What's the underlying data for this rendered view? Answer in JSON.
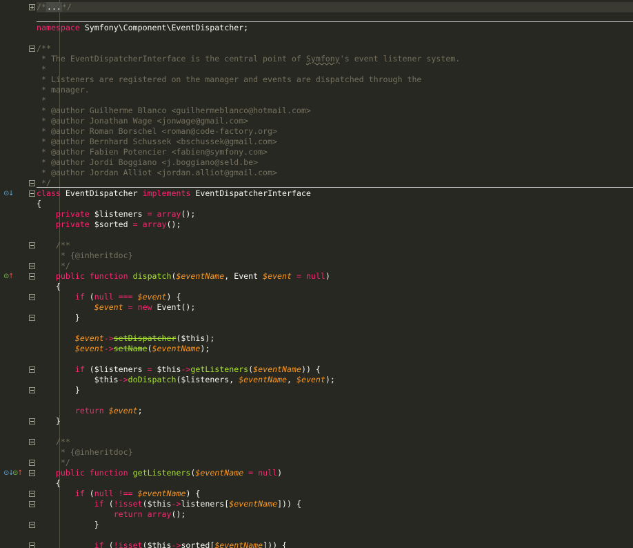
{
  "editor": {
    "language": "php",
    "colors": {
      "background": "#272822",
      "keyword": "#f92672",
      "function": "#a6e22e",
      "variable": "#fd971f",
      "comment": "#75715e",
      "text": "#f8f8f2"
    }
  },
  "lines": [
    {
      "t": [
        {
          "c": "cm",
          "v": "/*"
        },
        {
          "c": "fb",
          "v": "..."
        },
        {
          "c": "cm",
          "v": "*/"
        }
      ],
      "current": true
    },
    {
      "t": []
    },
    {
      "t": [
        {
          "c": "kw",
          "v": "namespace"
        },
        {
          "c": "plain",
          "v": " Symfony\\Component\\EventDispatcher;"
        }
      ]
    },
    {
      "t": []
    },
    {
      "t": [
        {
          "c": "cm",
          "v": "/**"
        }
      ]
    },
    {
      "t": [
        {
          "c": "cm",
          "v": " * The EventDispatcherInterface is the central point of "
        },
        {
          "c": "cmu",
          "v": "Symfony"
        },
        {
          "c": "cm",
          "v": "'s event listener system."
        }
      ]
    },
    {
      "t": [
        {
          "c": "cm",
          "v": " *"
        }
      ]
    },
    {
      "t": [
        {
          "c": "cm",
          "v": " * Listeners are registered on the manager and events are dispatched through the"
        }
      ]
    },
    {
      "t": [
        {
          "c": "cm",
          "v": " * manager."
        }
      ]
    },
    {
      "t": [
        {
          "c": "cm",
          "v": " *"
        }
      ]
    },
    {
      "t": [
        {
          "c": "cm",
          "v": " * @author Guilherme Blanco <guilhermeblanco@hotmail.com>"
        }
      ]
    },
    {
      "t": [
        {
          "c": "cm",
          "v": " * @author Jonathan Wage <jonwage@gmail.com>"
        }
      ]
    },
    {
      "t": [
        {
          "c": "cm",
          "v": " * @author Roman Borschel <roman@code-factory.org>"
        }
      ]
    },
    {
      "t": [
        {
          "c": "cm",
          "v": " * @author Bernhard Schussek <bschussek@gmail.com>"
        }
      ]
    },
    {
      "t": [
        {
          "c": "cm",
          "v": " * @author Fabien Potencier <fabien@symfony.com>"
        }
      ]
    },
    {
      "t": [
        {
          "c": "cm",
          "v": " * @author Jordi Boggiano <j.boggiano@seld.be>"
        }
      ]
    },
    {
      "t": [
        {
          "c": "cm",
          "v": " * @author Jordan Alliot <jordan.alliot@gmail.com>"
        }
      ]
    },
    {
      "t": [
        {
          "c": "cm",
          "v": " */"
        }
      ]
    },
    {
      "t": [
        {
          "c": "kw",
          "v": "class"
        },
        {
          "c": "plain",
          "v": " EventDispatcher "
        },
        {
          "c": "kw",
          "v": "implements"
        },
        {
          "c": "plain",
          "v": " EventDispatcherInterface"
        }
      ]
    },
    {
      "t": [
        {
          "c": "plain",
          "v": "{"
        }
      ]
    },
    {
      "t": [
        {
          "c": "plain",
          "v": "    "
        },
        {
          "c": "kw",
          "v": "private"
        },
        {
          "c": "plain",
          "v": " $listeners "
        },
        {
          "c": "kw",
          "v": "="
        },
        {
          "c": "plain",
          "v": " "
        },
        {
          "c": "kw",
          "v": "array"
        },
        {
          "c": "plain",
          "v": "();"
        }
      ]
    },
    {
      "t": [
        {
          "c": "plain",
          "v": "    "
        },
        {
          "c": "kw",
          "v": "private"
        },
        {
          "c": "plain",
          "v": " $sorted "
        },
        {
          "c": "kw",
          "v": "="
        },
        {
          "c": "plain",
          "v": " "
        },
        {
          "c": "kw",
          "v": "array"
        },
        {
          "c": "plain",
          "v": "();"
        }
      ]
    },
    {
      "t": []
    },
    {
      "t": [
        {
          "c": "cm",
          "v": "    /**"
        }
      ]
    },
    {
      "t": [
        {
          "c": "cm",
          "v": "     * {@inheritdoc}"
        }
      ]
    },
    {
      "t": [
        {
          "c": "cm",
          "v": "     */"
        }
      ]
    },
    {
      "t": [
        {
          "c": "plain",
          "v": "    "
        },
        {
          "c": "kw",
          "v": "public"
        },
        {
          "c": "plain",
          "v": " "
        },
        {
          "c": "kw",
          "v": "function"
        },
        {
          "c": "plain",
          "v": " "
        },
        {
          "c": "fn",
          "v": "dispatch"
        },
        {
          "c": "plain",
          "v": "("
        },
        {
          "c": "var",
          "v": "$eventName"
        },
        {
          "c": "plain",
          "v": ", Event "
        },
        {
          "c": "var",
          "v": "$event"
        },
        {
          "c": "plain",
          "v": " "
        },
        {
          "c": "kw",
          "v": "="
        },
        {
          "c": "plain",
          "v": " "
        },
        {
          "c": "kw",
          "v": "null"
        },
        {
          "c": "plain",
          "v": ")"
        }
      ]
    },
    {
      "t": [
        {
          "c": "plain",
          "v": "    {"
        }
      ]
    },
    {
      "t": [
        {
          "c": "plain",
          "v": "        "
        },
        {
          "c": "kw",
          "v": "if"
        },
        {
          "c": "plain",
          "v": " ("
        },
        {
          "c": "kw",
          "v": "null"
        },
        {
          "c": "plain",
          "v": " "
        },
        {
          "c": "kw",
          "v": "==="
        },
        {
          "c": "plain",
          "v": " "
        },
        {
          "c": "var",
          "v": "$event"
        },
        {
          "c": "plain",
          "v": ") {"
        }
      ]
    },
    {
      "t": [
        {
          "c": "plain",
          "v": "            "
        },
        {
          "c": "var",
          "v": "$event"
        },
        {
          "c": "plain",
          "v": " "
        },
        {
          "c": "kw",
          "v": "="
        },
        {
          "c": "plain",
          "v": " "
        },
        {
          "c": "kw",
          "v": "new"
        },
        {
          "c": "plain",
          "v": " Event();"
        }
      ]
    },
    {
      "t": [
        {
          "c": "plain",
          "v": "        }"
        }
      ]
    },
    {
      "t": []
    },
    {
      "t": [
        {
          "c": "plain",
          "v": "        "
        },
        {
          "c": "var",
          "v": "$event"
        },
        {
          "c": "kw",
          "v": "->"
        },
        {
          "c": "fns",
          "v": "setDispatcher"
        },
        {
          "c": "plain",
          "v": "($this);"
        }
      ]
    },
    {
      "t": [
        {
          "c": "plain",
          "v": "        "
        },
        {
          "c": "var",
          "v": "$event"
        },
        {
          "c": "kw",
          "v": "->"
        },
        {
          "c": "fns",
          "v": "setName"
        },
        {
          "c": "plain",
          "v": "("
        },
        {
          "c": "var",
          "v": "$eventName"
        },
        {
          "c": "plain",
          "v": ");"
        }
      ]
    },
    {
      "t": []
    },
    {
      "t": [
        {
          "c": "plain",
          "v": "        "
        },
        {
          "c": "kw",
          "v": "if"
        },
        {
          "c": "plain",
          "v": " ($listeners "
        },
        {
          "c": "kw",
          "v": "="
        },
        {
          "c": "plain",
          "v": " $this"
        },
        {
          "c": "kw",
          "v": "->"
        },
        {
          "c": "fn",
          "v": "getListeners"
        },
        {
          "c": "plain",
          "v": "("
        },
        {
          "c": "var",
          "v": "$eventName"
        },
        {
          "c": "plain",
          "v": ")) {"
        }
      ]
    },
    {
      "t": [
        {
          "c": "plain",
          "v": "            $this"
        },
        {
          "c": "kw",
          "v": "->"
        },
        {
          "c": "fn",
          "v": "doDispatch"
        },
        {
          "c": "plain",
          "v": "($listeners, "
        },
        {
          "c": "var",
          "v": "$eventName"
        },
        {
          "c": "plain",
          "v": ", "
        },
        {
          "c": "var",
          "v": "$event"
        },
        {
          "c": "plain",
          "v": ");"
        }
      ]
    },
    {
      "t": [
        {
          "c": "plain",
          "v": "        }"
        }
      ]
    },
    {
      "t": []
    },
    {
      "t": [
        {
          "c": "plain",
          "v": "        "
        },
        {
          "c": "kw",
          "v": "return"
        },
        {
          "c": "plain",
          "v": " "
        },
        {
          "c": "var",
          "v": "$event"
        },
        {
          "c": "plain",
          "v": ";"
        }
      ]
    },
    {
      "t": [
        {
          "c": "plain",
          "v": "    }"
        }
      ]
    },
    {
      "t": []
    },
    {
      "t": [
        {
          "c": "cm",
          "v": "    /**"
        }
      ]
    },
    {
      "t": [
        {
          "c": "cm",
          "v": "     * {@inheritdoc}"
        }
      ]
    },
    {
      "t": [
        {
          "c": "cm",
          "v": "     */"
        }
      ]
    },
    {
      "t": [
        {
          "c": "plain",
          "v": "    "
        },
        {
          "c": "kw",
          "v": "public"
        },
        {
          "c": "plain",
          "v": " "
        },
        {
          "c": "kw",
          "v": "function"
        },
        {
          "c": "plain",
          "v": " "
        },
        {
          "c": "fn",
          "v": "getListeners"
        },
        {
          "c": "plain",
          "v": "("
        },
        {
          "c": "var",
          "v": "$eventName"
        },
        {
          "c": "plain",
          "v": " "
        },
        {
          "c": "kw",
          "v": "="
        },
        {
          "c": "plain",
          "v": " "
        },
        {
          "c": "kw",
          "v": "null"
        },
        {
          "c": "plain",
          "v": ")"
        }
      ]
    },
    {
      "t": [
        {
          "c": "plain",
          "v": "    {"
        }
      ]
    },
    {
      "t": [
        {
          "c": "plain",
          "v": "        "
        },
        {
          "c": "kw",
          "v": "if"
        },
        {
          "c": "plain",
          "v": " ("
        },
        {
          "c": "kw",
          "v": "null"
        },
        {
          "c": "plain",
          "v": " "
        },
        {
          "c": "kw",
          "v": "!=="
        },
        {
          "c": "plain",
          "v": " "
        },
        {
          "c": "var",
          "v": "$eventName"
        },
        {
          "c": "plain",
          "v": ") {"
        }
      ]
    },
    {
      "t": [
        {
          "c": "plain",
          "v": "            "
        },
        {
          "c": "kw",
          "v": "if"
        },
        {
          "c": "plain",
          "v": " ("
        },
        {
          "c": "kw",
          "v": "!"
        },
        {
          "c": "kw",
          "v": "isset"
        },
        {
          "c": "plain",
          "v": "($this"
        },
        {
          "c": "kw",
          "v": "->"
        },
        {
          "c": "plain",
          "v": "listeners["
        },
        {
          "c": "var",
          "v": "$eventName"
        },
        {
          "c": "plain",
          "v": "])) {"
        }
      ]
    },
    {
      "t": [
        {
          "c": "plain",
          "v": "                "
        },
        {
          "c": "kw",
          "v": "return"
        },
        {
          "c": "plain",
          "v": " "
        },
        {
          "c": "kw",
          "v": "array"
        },
        {
          "c": "plain",
          "v": "();"
        }
      ]
    },
    {
      "t": [
        {
          "c": "plain",
          "v": "            }"
        }
      ]
    },
    {
      "t": []
    },
    {
      "t": [
        {
          "c": "plain",
          "v": "            "
        },
        {
          "c": "kw",
          "v": "if"
        },
        {
          "c": "plain",
          "v": " ("
        },
        {
          "c": "kw",
          "v": "!"
        },
        {
          "c": "kw",
          "v": "isset"
        },
        {
          "c": "plain",
          "v": "($this"
        },
        {
          "c": "kw",
          "v": "->"
        },
        {
          "c": "plain",
          "v": "sorted["
        },
        {
          "c": "var",
          "v": "$eventName"
        },
        {
          "c": "plain",
          "v": "])) {"
        }
      ]
    }
  ],
  "gutter_markers": [
    {
      "line": 18,
      "icons": [
        {
          "name": "implements-marker-icon",
          "glyph": "⊙",
          "color": "blue"
        },
        {
          "name": "down-arrow-icon",
          "glyph": "↓",
          "color": "blue"
        }
      ]
    },
    {
      "line": 26,
      "icons": [
        {
          "name": "override-marker-icon",
          "glyph": "⊙",
          "color": "green"
        },
        {
          "name": "up-arrow-icon",
          "glyph": "↑",
          "color": "red"
        }
      ]
    },
    {
      "line": 45,
      "icons": [
        {
          "name": "implements-marker-icon",
          "glyph": "⊙",
          "color": "blue"
        },
        {
          "name": "down-arrow-icon",
          "glyph": "↓",
          "color": "blue"
        },
        {
          "name": "override-marker-icon",
          "glyph": "⊙",
          "color": "green"
        },
        {
          "name": "up-arrow-icon",
          "glyph": "↑",
          "color": "red"
        }
      ]
    }
  ],
  "folds": [
    {
      "line": 0,
      "state": "collapsed"
    },
    {
      "line": 4,
      "state": "open"
    },
    {
      "line": 17,
      "state": "open"
    },
    {
      "line": 18,
      "state": "open"
    },
    {
      "line": 23,
      "state": "open"
    },
    {
      "line": 25,
      "state": "open"
    },
    {
      "line": 26,
      "state": "open"
    },
    {
      "line": 28,
      "state": "open"
    },
    {
      "line": 30,
      "state": "open"
    },
    {
      "line": 35,
      "state": "open"
    },
    {
      "line": 37,
      "state": "open"
    },
    {
      "line": 40,
      "state": "open"
    },
    {
      "line": 42,
      "state": "open"
    },
    {
      "line": 44,
      "state": "open"
    },
    {
      "line": 45,
      "state": "open"
    },
    {
      "line": 47,
      "state": "open"
    },
    {
      "line": 48,
      "state": "open"
    },
    {
      "line": 50,
      "state": "open"
    },
    {
      "line": 52,
      "state": "open"
    }
  ]
}
